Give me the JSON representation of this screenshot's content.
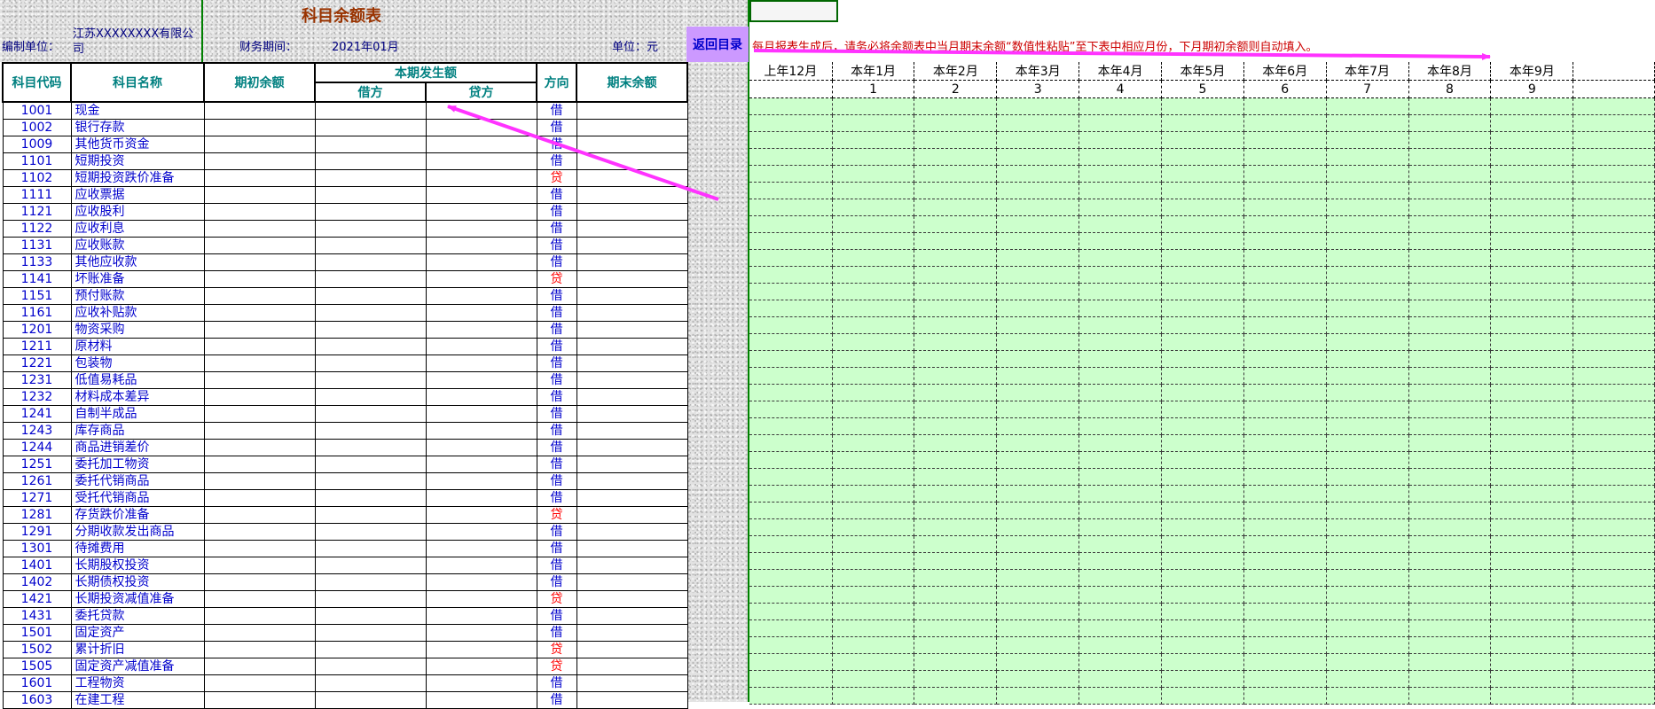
{
  "header": {
    "title": "科目余额表",
    "unit_label": "编制单位：",
    "unit_value": "江苏XXXXXXXX有限公司",
    "period_label": "财务期间：",
    "period_value": "2021年01月",
    "currency_label": "单位：元",
    "return_button": "返回目录",
    "notice": "每月报表生成后，请务必将余额表中当月期末余额“数值性粘贴”至下表中相应月份，下月期初余额则自动填入。"
  },
  "ledger": {
    "headers": {
      "code": "科目代码",
      "name": "科目名称",
      "opening": "期初余额",
      "period_amount": "本期发生额",
      "debit": "借方",
      "credit": "贷方",
      "direction": "方向",
      "closing": "期末余额"
    },
    "rows": [
      {
        "code": "1001",
        "name": "现金",
        "direction": "借"
      },
      {
        "code": "1002",
        "name": "银行存款",
        "direction": "借"
      },
      {
        "code": "1009",
        "name": "其他货币资金",
        "direction": "借"
      },
      {
        "code": "1101",
        "name": "短期投资",
        "direction": "借"
      },
      {
        "code": "1102",
        "name": "短期投资跌价准备",
        "direction": "贷"
      },
      {
        "code": "1111",
        "name": "应收票据",
        "direction": "借"
      },
      {
        "code": "1121",
        "name": "应收股利",
        "direction": "借"
      },
      {
        "code": "1122",
        "name": "应收利息",
        "direction": "借"
      },
      {
        "code": "1131",
        "name": "应收账款",
        "direction": "借"
      },
      {
        "code": "1133",
        "name": "其他应收款",
        "direction": "借"
      },
      {
        "code": "1141",
        "name": "坏账准备",
        "direction": "贷"
      },
      {
        "code": "1151",
        "name": "预付账款",
        "direction": "借"
      },
      {
        "code": "1161",
        "name": "应收补贴款",
        "direction": "借"
      },
      {
        "code": "1201",
        "name": "物资采购",
        "direction": "借"
      },
      {
        "code": "1211",
        "name": "原材料",
        "direction": "借"
      },
      {
        "code": "1221",
        "name": "包装物",
        "direction": "借"
      },
      {
        "code": "1231",
        "name": "低值易耗品",
        "direction": "借"
      },
      {
        "code": "1232",
        "name": "材料成本差异",
        "direction": "借"
      },
      {
        "code": "1241",
        "name": "自制半成品",
        "direction": "借"
      },
      {
        "code": "1243",
        "name": "库存商品",
        "direction": "借"
      },
      {
        "code": "1244",
        "name": "商品进销差价",
        "direction": "借"
      },
      {
        "code": "1251",
        "name": "委托加工物资",
        "direction": "借"
      },
      {
        "code": "1261",
        "name": "委托代销商品",
        "direction": "借"
      },
      {
        "code": "1271",
        "name": "受托代销商品",
        "direction": "借"
      },
      {
        "code": "1281",
        "name": "存货跌价准备",
        "direction": "贷"
      },
      {
        "code": "1291",
        "name": "分期收款发出商品",
        "direction": "借"
      },
      {
        "code": "1301",
        "name": "待摊费用",
        "direction": "借"
      },
      {
        "code": "1401",
        "name": "长期股权投资",
        "direction": "借"
      },
      {
        "code": "1402",
        "name": "长期债权投资",
        "direction": "借"
      },
      {
        "code": "1421",
        "name": "长期投资减值准备",
        "direction": "贷"
      },
      {
        "code": "1431",
        "name": "委托贷款",
        "direction": "借"
      },
      {
        "code": "1501",
        "name": "固定资产",
        "direction": "借"
      },
      {
        "code": "1502",
        "name": "累计折旧",
        "direction": "贷"
      },
      {
        "code": "1505",
        "name": "固定资产减值准备",
        "direction": "贷"
      },
      {
        "code": "1601",
        "name": "工程物资",
        "direction": "借"
      },
      {
        "code": "1603",
        "name": "在建工程",
        "direction": "借"
      }
    ]
  },
  "monthly": {
    "headers": [
      "上年12月",
      "本年1月",
      "本年2月",
      "本年3月",
      "本年4月",
      "本年5月",
      "本年6月",
      "本年7月",
      "本年8月",
      "本年9月"
    ],
    "numbers": [
      "",
      "1",
      "2",
      "3",
      "4",
      "5",
      "6",
      "7",
      "8",
      "9"
    ]
  },
  "colors": {
    "credit_direction": "#ff0000",
    "debit_direction": "#0000cc",
    "grid_fill": "#ccffcc",
    "arrow": "#ff33ff"
  }
}
